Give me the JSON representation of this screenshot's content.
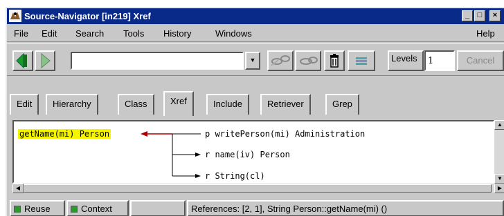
{
  "window": {
    "title": "Source-Navigator [in219] Xref",
    "controls": {
      "minimize": "_",
      "maximize": "□",
      "close": "×"
    }
  },
  "menu": {
    "file": "File",
    "edit": "Edit",
    "search": "Search",
    "tools": "Tools",
    "history": "History",
    "windows": "Windows",
    "help": "Help"
  },
  "toolbar": {
    "symbol_value": "",
    "levels_label": "Levels",
    "levels_value": "1",
    "cancel_label": "Cancel",
    "icons": [
      "back-arrow-icon",
      "forward-arrow-icon",
      "combo-dropdown-icon",
      "graph-icon",
      "hide-icon",
      "trash-icon",
      "grid-icon"
    ]
  },
  "tabs": [
    {
      "label": "Edit"
    },
    {
      "label": "Hierarchy"
    },
    {
      "label": "Class"
    },
    {
      "label": "Xref",
      "active": true
    },
    {
      "label": "Include"
    },
    {
      "label": "Retriever"
    },
    {
      "label": "Grep"
    }
  ],
  "xref": {
    "root": "getName(mi) Person",
    "children": [
      {
        "label": "p writePerson(mi) Administration"
      },
      {
        "label": "r name(iv) Person"
      },
      {
        "label": "r String(cl)"
      }
    ]
  },
  "status": {
    "reuse": "Reuse",
    "context": "Context",
    "message": "References: [2, 1], String  Person::getName(mi) ()"
  },
  "colors": {
    "title_bar": "#0a2a8a",
    "highlight": "#f5f500",
    "arrow_in": "#aa0000",
    "checkbox": "#2a9a2a"
  }
}
